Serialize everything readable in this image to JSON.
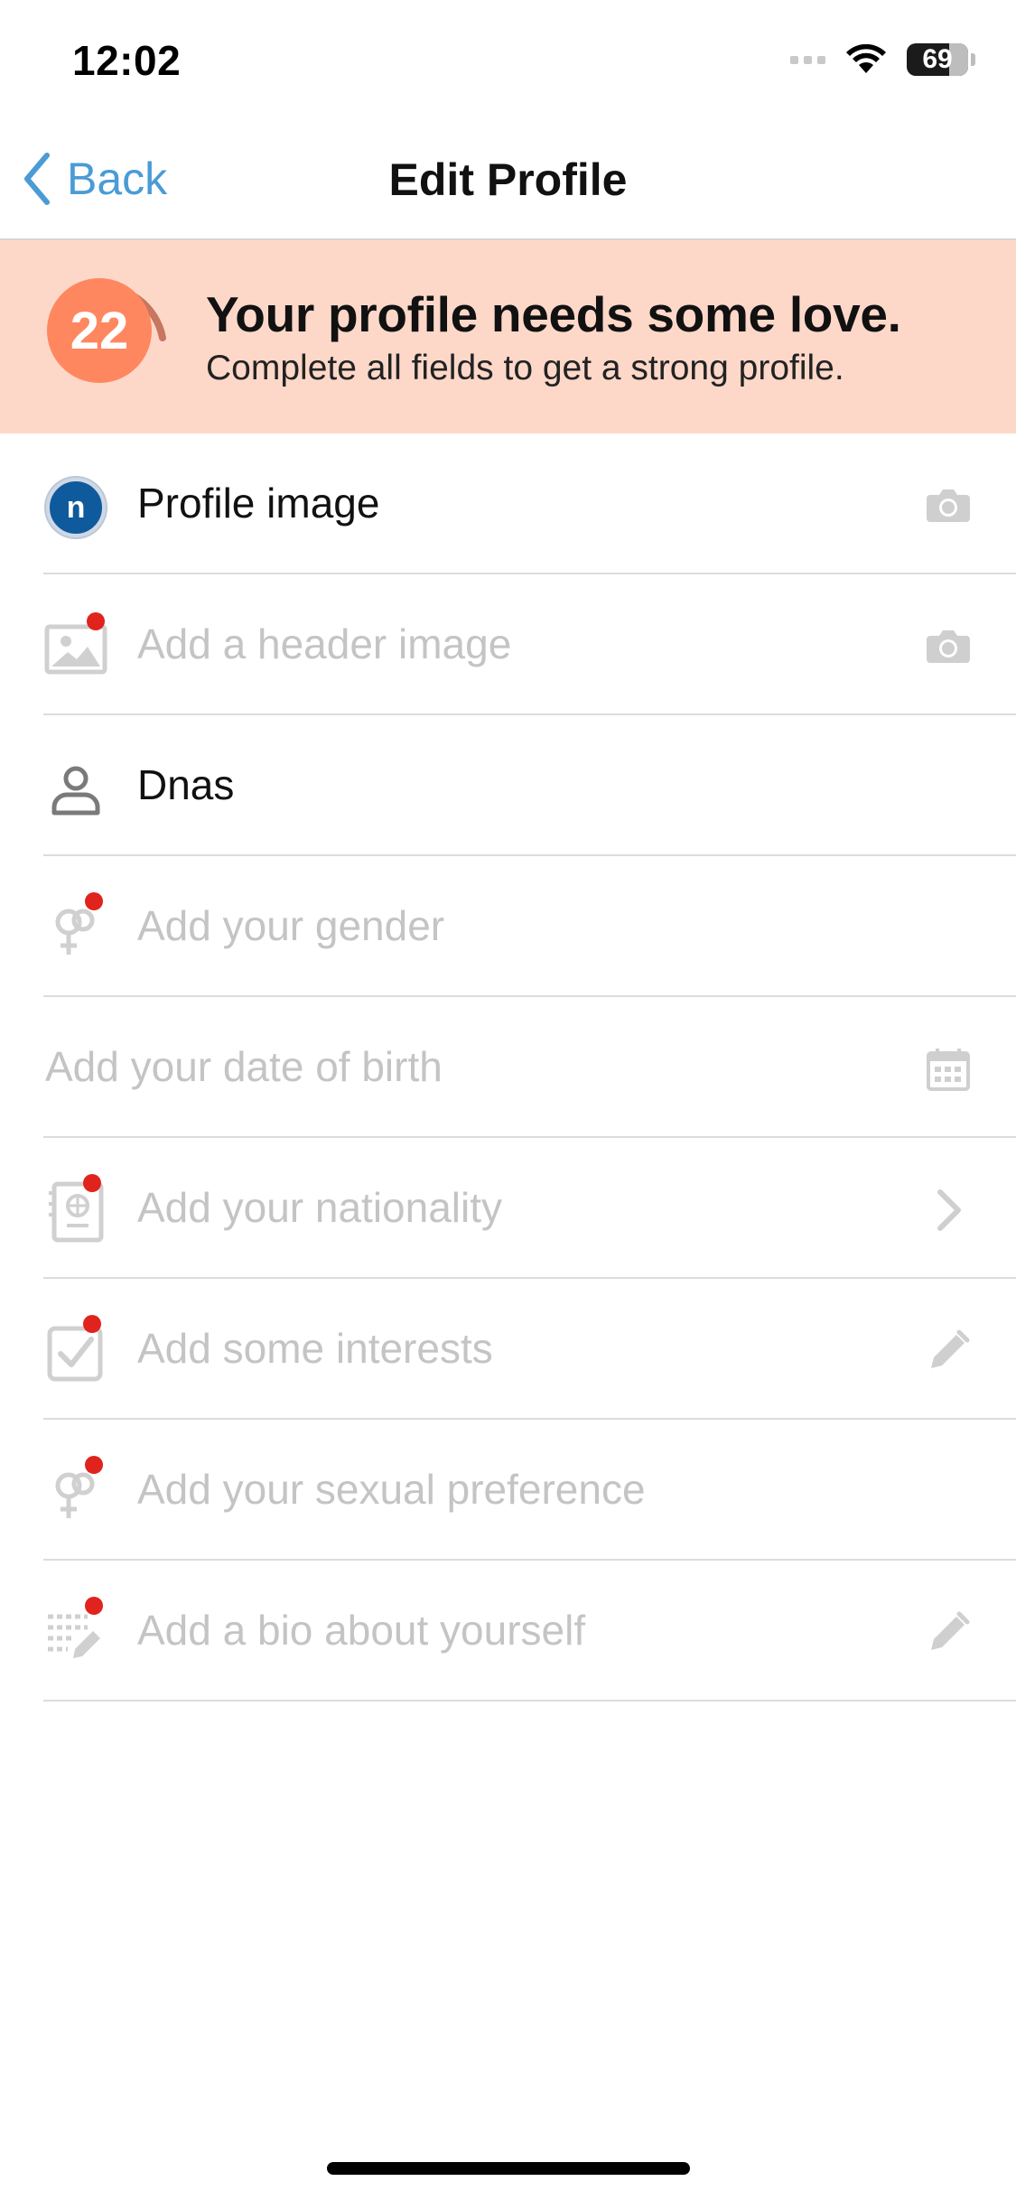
{
  "status_bar": {
    "time": "12:02",
    "battery": "69",
    "battery_level": 0.69
  },
  "nav": {
    "back_label": "Back",
    "title": "Edit Profile"
  },
  "banner": {
    "score": "22",
    "title": "Your profile needs some love.",
    "subtitle": "Complete all fields to get a strong profile.",
    "background": "#fdd8c9",
    "accent": "#ff8760"
  },
  "rows": [
    {
      "name": "profile-image",
      "label": "Profile image",
      "icon": "avatar",
      "avatar_letter": "n",
      "trailing": "camera-icon",
      "filled": true
    },
    {
      "name": "header-image",
      "label": "Add a header image",
      "icon": "image-icon",
      "trailing": "camera-icon",
      "required": true
    },
    {
      "name": "username",
      "label": "Dnas",
      "icon": "person-icon",
      "filled": true
    },
    {
      "name": "gender",
      "label": "Add your gender",
      "icon": "gender-icon",
      "required": true
    },
    {
      "name": "date-of-birth",
      "label": "Add your date of birth",
      "trailing": "calendar-icon"
    },
    {
      "name": "nationality",
      "label": "Add your nationality",
      "icon": "passport-icon",
      "trailing": "chevron-right-icon",
      "required": true
    },
    {
      "name": "interests",
      "label": "Add some interests",
      "icon": "checkbox-icon",
      "trailing": "pencil-icon",
      "required": true
    },
    {
      "name": "sexual-preference",
      "label": "Add your sexual preference",
      "icon": "gender-icon",
      "required": true
    },
    {
      "name": "bio",
      "label": "Add a bio about yourself",
      "icon": "text-lines-icon",
      "trailing": "pencil-icon",
      "required": true
    }
  ]
}
